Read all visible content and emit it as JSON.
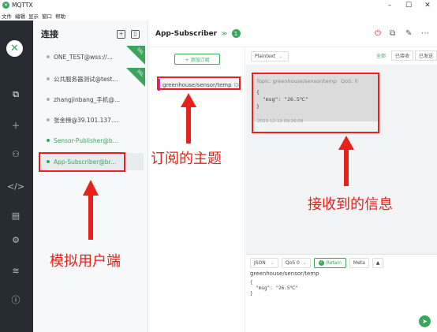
{
  "app": {
    "title": "MQTTX"
  },
  "window_controls": {
    "minimize": "–",
    "maximize": "☐",
    "close": "✕"
  },
  "menu": [
    "文件",
    "编辑",
    "显示",
    "窗口",
    "帮助"
  ],
  "connections": {
    "title": "连接",
    "items": [
      {
        "label": "ONE_TEST@wss://...",
        "status": "offline",
        "ssl": true
      },
      {
        "label": "公共服务器测试@test...",
        "status": "offline",
        "ssl": true
      },
      {
        "label": "zhangjinbang_手机@...",
        "status": "offline",
        "ssl": false
      },
      {
        "label": "张金榜@39.101.137....",
        "status": "offline",
        "ssl": false
      },
      {
        "label": "Sensor-Publisher@b...",
        "status": "online",
        "ssl": false
      },
      {
        "label": "App-Subscriber@br...",
        "status": "online",
        "ssl": false
      }
    ],
    "ssl_label": "SSL"
  },
  "main": {
    "title": "App-Subscriber",
    "badge": "1",
    "add_subscription": "+ 添加订阅",
    "subscription": {
      "topic": "greenhouse/sensor/temp",
      "qos": "QoS 0"
    },
    "payload_format": "Plaintext",
    "filters": [
      "全部",
      "已接收",
      "已发送"
    ],
    "message": {
      "topic_line": "Topic: greenhouse/sensor/temp",
      "qos": "QoS: 0",
      "payload": "{\n  \"msg\": \"26.5℃\"\n}",
      "time": "2023-12-19 09:26:09"
    },
    "publish": {
      "format": "JSON",
      "qos": "QoS 0",
      "retain": "Retain",
      "meta": "Meta",
      "topic": "greenhouse/sensor/temp",
      "payload": "{\n  \"msg\": \"26.5℃\"\n}"
    }
  },
  "annotations": {
    "subscribe_topic": "订阅的主题",
    "received_message": "接收到的信息",
    "simulated_client": "模拟用户端"
  },
  "colors": {
    "accent": "#3ba55c",
    "annotation": "#e8211a",
    "rail": "#272c33"
  }
}
